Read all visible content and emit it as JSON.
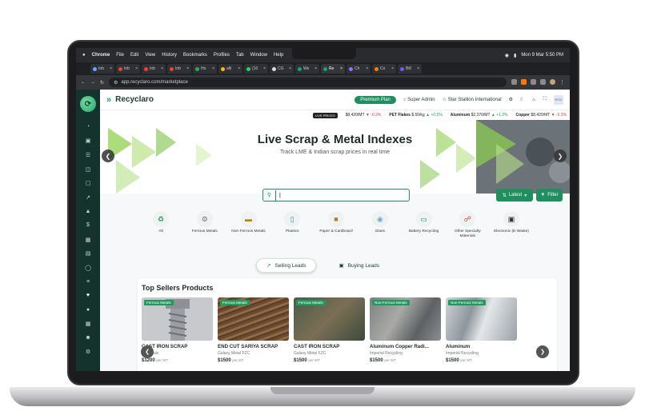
{
  "mac_menu": {
    "app": "Chrome",
    "items": [
      "File",
      "Edit",
      "View",
      "History",
      "Bookmarks",
      "Profiles",
      "Tab",
      "Window",
      "Help"
    ],
    "datetime": "Mon 9 Mar  5:50 PM"
  },
  "tabs": [
    {
      "label": "Inb"
    },
    {
      "label": "Inb"
    },
    {
      "label": "Inb"
    },
    {
      "label": "Inb"
    },
    {
      "label": "Ho"
    },
    {
      "label": "alli"
    },
    {
      "label": "(10"
    },
    {
      "label": "CG"
    },
    {
      "label": "We"
    },
    {
      "label": "Re",
      "active": true
    },
    {
      "label": "Ch"
    },
    {
      "label": "Co"
    },
    {
      "label": "Bill"
    }
  ],
  "address": {
    "url": "app.recyclaro.com/marketplace"
  },
  "brand": {
    "name": "Recyclaro"
  },
  "topbar": {
    "premium": "Premium Plan",
    "role": "Super Admin",
    "org": "Star Stallion International",
    "avatar": "RISK"
  },
  "ticker": {
    "live": "LIVE PRICES",
    "items": [
      {
        "value": "$8,420/MT",
        "change": "-0.3%",
        "dir": "dn"
      },
      {
        "label": "PET Flakes",
        "value": "$.55/kg",
        "change": "+0.5%",
        "dir": "up"
      },
      {
        "label": "Aluminum",
        "value": "$2,370/MT",
        "change": "+1.2%",
        "dir": "up"
      },
      {
        "label": "Copper",
        "value": "$8,420/MT",
        "change": "-0.3%",
        "dir": "dn"
      }
    ]
  },
  "hero": {
    "title": "Live Scrap & Metal Indexes",
    "subtitle": "Track LME & Indian scrap prices in real time"
  },
  "search": {
    "value": "|",
    "placeholder": ""
  },
  "buttons": {
    "latest": "Latest",
    "filter": "Filter"
  },
  "categories": [
    {
      "label": "All",
      "icon": "recycle-icon"
    },
    {
      "label": "Ferrous Metals",
      "icon": "bolt-icon"
    },
    {
      "label": "Non-Ferrous Metals",
      "icon": "ingot-icon"
    },
    {
      "label": "Plastics",
      "icon": "bottle-icon"
    },
    {
      "label": "Paper & Cardboard",
      "icon": "box-icon"
    },
    {
      "label": "Glass",
      "icon": "glass-icon"
    },
    {
      "label": "Battery Recycling",
      "icon": "battery-icon"
    },
    {
      "label": "Other Specialty Materials",
      "icon": "link-icon"
    },
    {
      "label": "Electronic (E-Waste)",
      "icon": "monitor-icon"
    }
  ],
  "leads": {
    "selling": "Selling Leads",
    "buying": "Buying Leads"
  },
  "products": {
    "title": "Top Sellers Products",
    "items": [
      {
        "tag": "Ferrous Metals",
        "name": "CAST IRON SCRAP",
        "seller": "us Metals",
        "price": "$1200",
        "unit": "per MT",
        "color": "#b9bcbf"
      },
      {
        "tag": "Ferrous Metals",
        "name": "END CUT SARIYA SCRAP",
        "seller": "Galaxy Metal FZC",
        "price": "$1500",
        "unit": "per MT",
        "color": "#7a5a3e"
      },
      {
        "tag": "Ferrous Metals",
        "name": "CAST IRON SCRAP",
        "seller": "Galaxy Metal FZC",
        "price": "$1500",
        "unit": "per MT",
        "color": "#5d6b5a"
      },
      {
        "tag": "Non-Ferrous Metals",
        "name": "Aluminum Copper Radi...",
        "seller": "Imperial Recycling",
        "price": "$1500",
        "unit": "per MT",
        "color": "#8c9092"
      },
      {
        "tag": "Non-Ferrous Metals",
        "name": "Aluminum",
        "seller": "Imperial Recycling",
        "price": "$1500",
        "unit": "per MT",
        "color": "#a8adb3"
      }
    ]
  },
  "sidebar_icons": [
    "dashboard-icon",
    "bag-icon",
    "list-icon",
    "folder-icon",
    "chat-icon",
    "chart-icon",
    "cube-icon",
    "dollar-icon",
    "truck-icon",
    "report-icon",
    "shield-icon",
    "bars-icon",
    "heart-icon",
    "user-icon",
    "grid-icon",
    "users-icon",
    "settings-icon"
  ]
}
